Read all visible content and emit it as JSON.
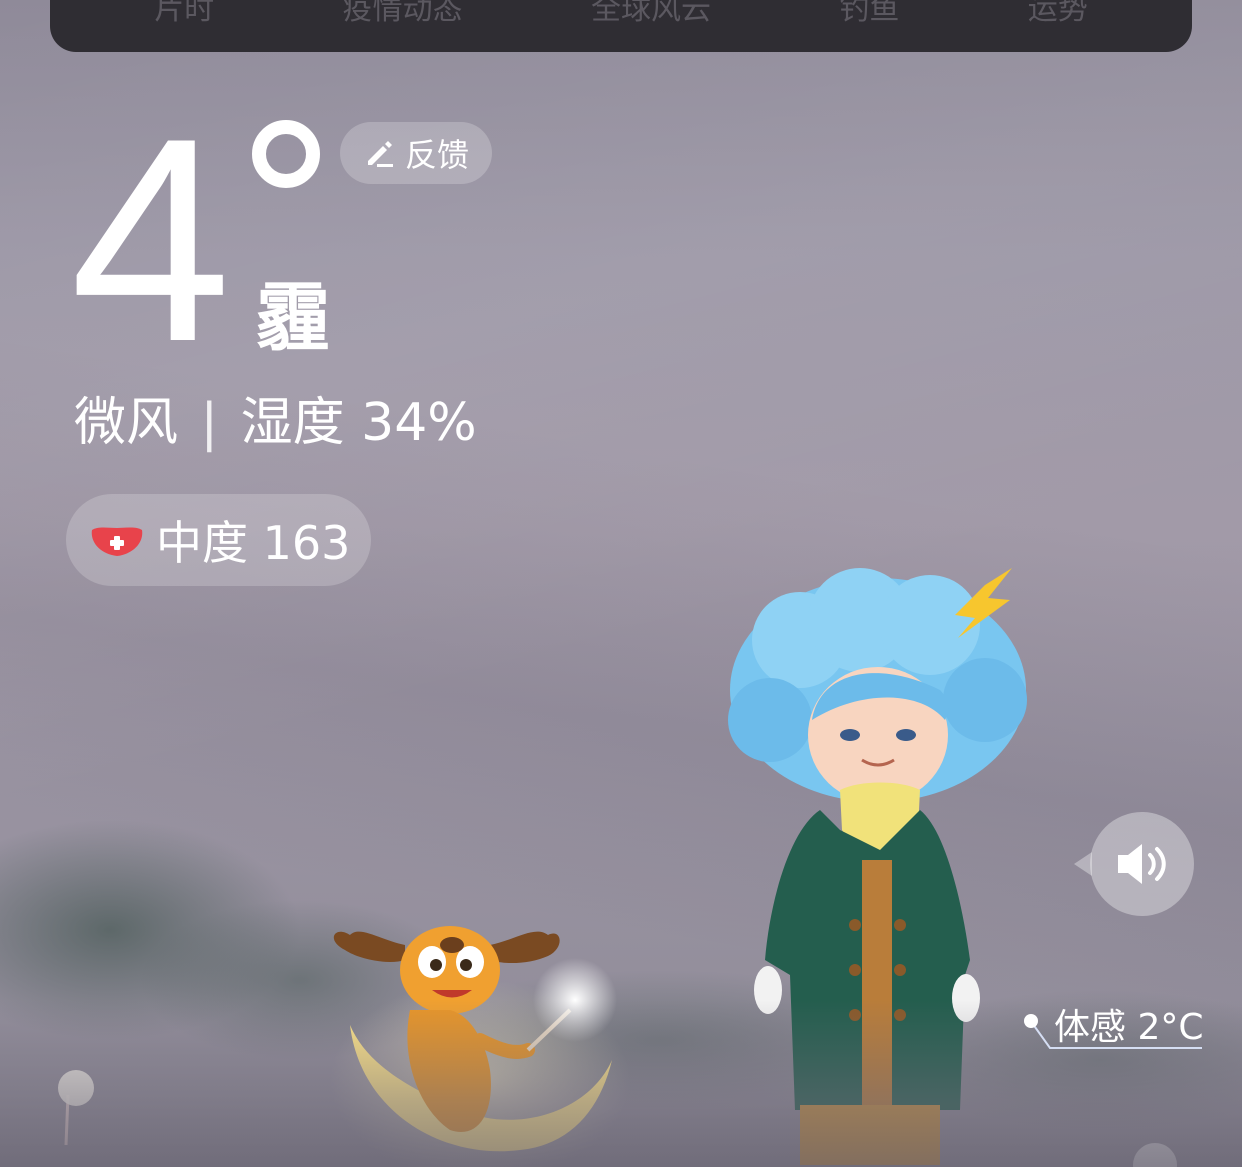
{
  "nav": {
    "items": [
      "片时",
      "疫情动态",
      "全球风云",
      "钓鱼",
      "运势"
    ]
  },
  "weather": {
    "temperature": "4",
    "condition": "霾",
    "wind": "微风",
    "humidity": "湿度 34%",
    "separator": "|",
    "aqi": "中度 163",
    "feels_like": "体感 2°C"
  },
  "feedback": {
    "label": "反馈"
  },
  "icons": {
    "feedback": "pencil-icon",
    "aqi": "mask-icon",
    "speaker": "speaker-icon"
  },
  "colors": {
    "background": "#9c97a6",
    "nav_bg": "#2f2d33",
    "mask_red": "#e8434b"
  }
}
